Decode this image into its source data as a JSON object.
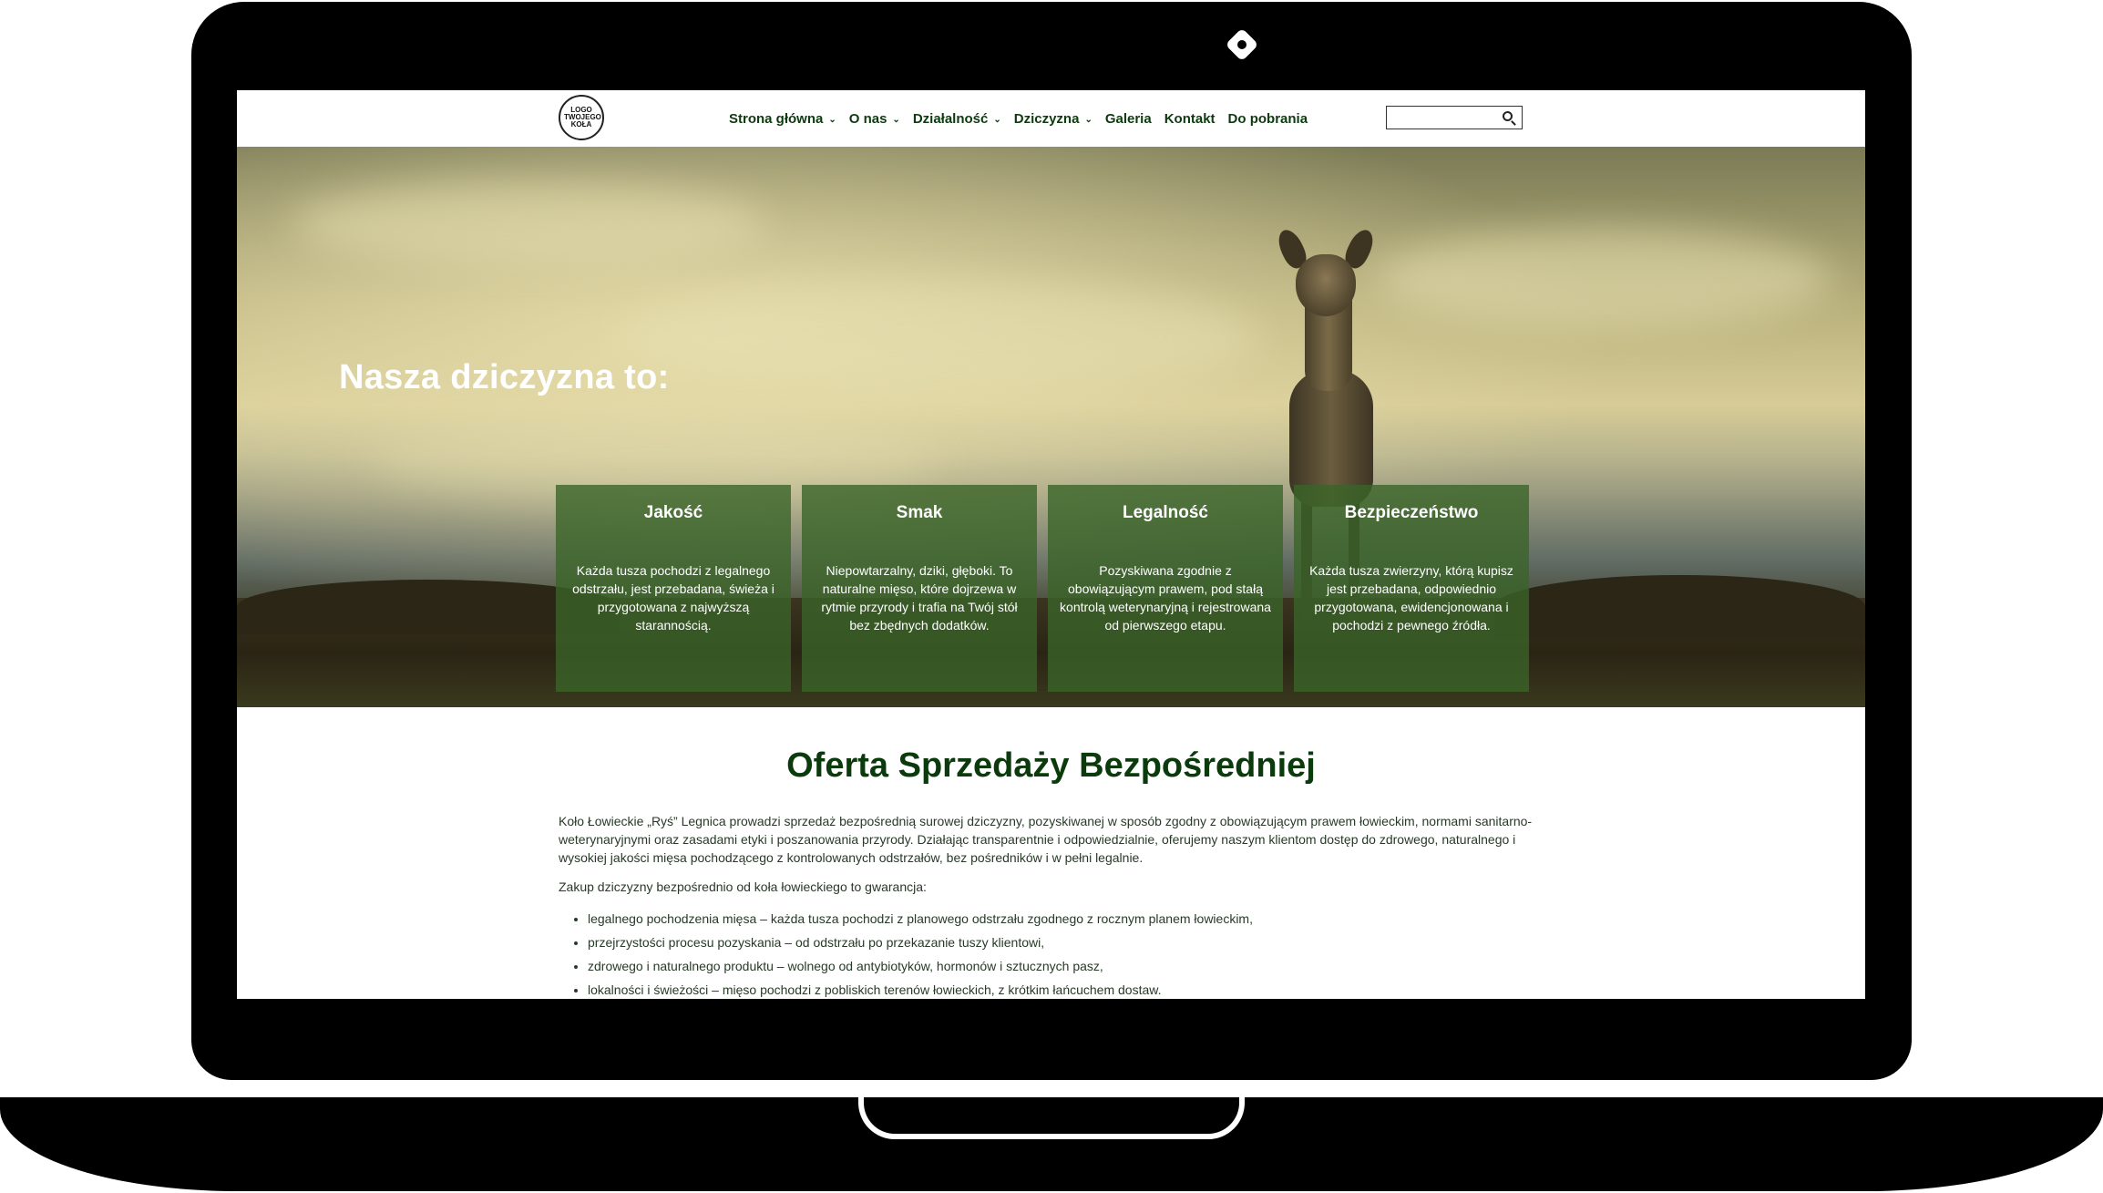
{
  "logo": {
    "lines": [
      "LOGO",
      "TWOJEGO",
      "KOŁA"
    ]
  },
  "nav": {
    "items": [
      {
        "label": "Strona główna",
        "has_dropdown": true
      },
      {
        "label": "O nas",
        "has_dropdown": true
      },
      {
        "label": "Działalność",
        "has_dropdown": true
      },
      {
        "label": "Dziczyzna",
        "has_dropdown": true
      },
      {
        "label": "Galeria",
        "has_dropdown": false
      },
      {
        "label": "Kontakt",
        "has_dropdown": false
      },
      {
        "label": "Do pobrania",
        "has_dropdown": false
      }
    ],
    "search": {
      "value": "",
      "placeholder": ""
    }
  },
  "hero": {
    "title": "Nasza dziczyzna to:",
    "cards": [
      {
        "title": "Jakość",
        "text": "Każda tusza pochodzi z legalnego odstrzału, jest przebadana, świeża i przygotowana z najwyższą starannością."
      },
      {
        "title": "Smak",
        "text": "Niepowtarzalny, dziki, głęboki. To naturalne mięso, które dojrzewa w rytmie przyrody i trafia na Twój stół bez zbędnych dodatków."
      },
      {
        "title": "Legalność",
        "text": "Pozyskiwana zgodnie z obowiązującym prawem, pod stałą kontrolą weterynaryjną i rejestrowana od pierwszego etapu."
      },
      {
        "title": "Bezpieczeństwo",
        "text": "Każda tusza zwierzyny, którą kupisz jest przebadana, odpowiednio przygotowana, ewidencjonowana i pochodzi z pewnego źródła."
      }
    ]
  },
  "offer": {
    "title": "Oferta Sprzedaży Bezpośredniej",
    "paragraph": "Koło Łowieckie „Ryś” Legnica prowadzi sprzedaż bezpośrednią surowej dziczyzny, pozyskiwanej w sposób zgodny z obowiązującym prawem łowieckim, normami sanitarno-weterynaryjnymi oraz zasadami etyki i poszanowania przyrody. Działając transparentnie i odpowiedzialnie, oferujemy naszym klientom dostęp do zdrowego, naturalnego i wysokiej jakości mięsa pochodzącego z kontrolowanych odstrzałów, bez pośredników i w pełni legalnie.",
    "intro": "Zakup dziczyzny bezpośrednio od koła łowieckiego to gwarancja:",
    "list": [
      "legalnego pochodzenia mięsa – każda tusza pochodzi z planowego odstrzału zgodnego z rocznym planem łowieckim,",
      "przejrzystości procesu pozyskania – od odstrzału po przekazanie tuszy klientowi,",
      "zdrowego i naturalnego produktu – wolnego od antybiotyków, hormonów i sztucznych pasz,",
      "lokalności i świeżości – mięso pochodzi z pobliskich terenów łowieckich, z krótkim łańcuchem dostaw."
    ]
  },
  "colors": {
    "nav_text": "#0e3a10",
    "card_bg": "#3a6428",
    "title_green": "#0b3a0c",
    "body_text": "#283a28"
  }
}
